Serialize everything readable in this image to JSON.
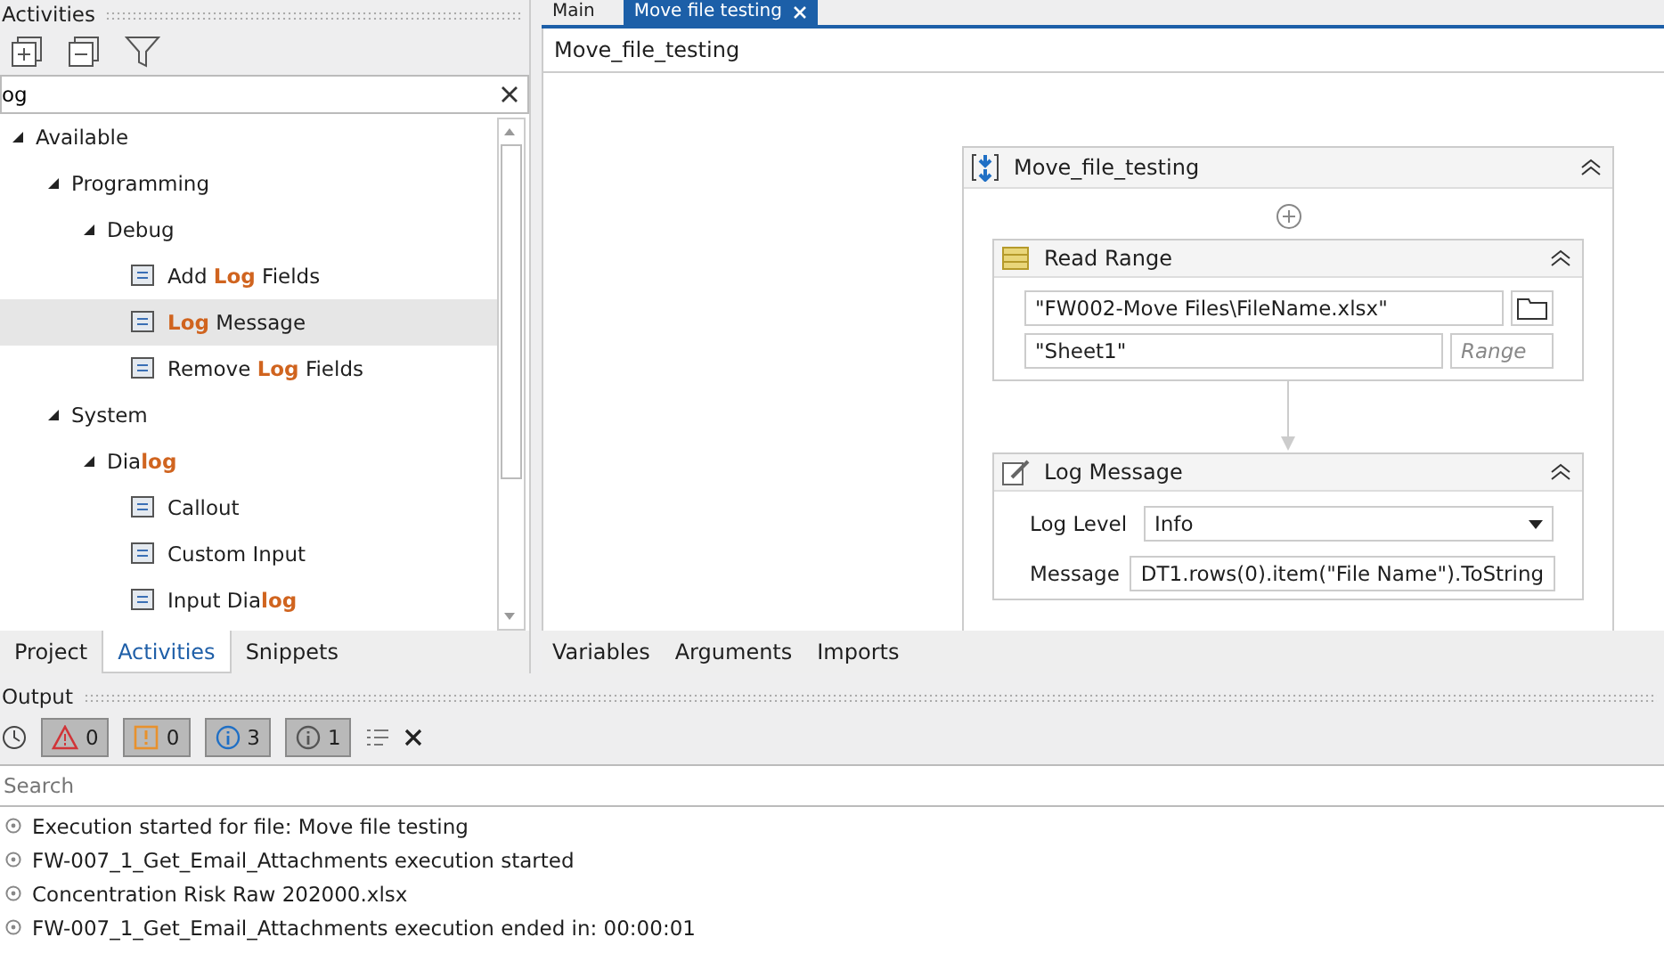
{
  "activities_panel": {
    "title": "Activities",
    "search": {
      "value": "og"
    },
    "tree": [
      {
        "label": "Available",
        "expanded": true,
        "children": [
          {
            "label": "Programming",
            "expanded": true,
            "children": [
              {
                "label": "Debug",
                "expanded": true,
                "children": [
                  {
                    "label": "Add **Log** Fields",
                    "selected": false
                  },
                  {
                    "label": "**Log** Message",
                    "selected": true
                  },
                  {
                    "label": "Remove **Log** Fields",
                    "selected": false
                  }
                ]
              }
            ]
          },
          {
            "label": "System",
            "expanded": true,
            "children": [
              {
                "label": "Dia**log**",
                "expanded": true,
                "children": [
                  {
                    "label": "Callout",
                    "selected": false
                  },
                  {
                    "label": "Custom Input",
                    "selected": false
                  },
                  {
                    "label": "Input Dia**log**",
                    "selected": false
                  }
                ]
              }
            ]
          }
        ]
      }
    ],
    "tabs": [
      {
        "label": "Project",
        "selected": false
      },
      {
        "label": "Activities",
        "selected": true
      },
      {
        "label": "Snippets",
        "selected": false
      }
    ]
  },
  "document_tabs": [
    {
      "label": "Main",
      "selected": false
    },
    {
      "label": "Move file testing",
      "selected": true
    }
  ],
  "breadcrumb": "Move_file_testing",
  "sequence": {
    "title": "Move_file_testing",
    "activities": [
      {
        "kind": "read_range",
        "title": "Read Range",
        "path": "\"FW002-Move Files\\FileName.xlsx\"",
        "sheet": "\"Sheet1\"",
        "range_placeholder": "Range"
      },
      {
        "kind": "log_message",
        "title": "Log Message",
        "fields": [
          {
            "kind": "dropdown",
            "label": "Log Level",
            "value": "Info"
          },
          {
            "kind": "text",
            "label": "Message",
            "value": "DT1.rows(0).item(\"File Name\").ToString"
          }
        ]
      }
    ]
  },
  "designer_tabs": [
    "Variables",
    "Arguments",
    "Imports"
  ],
  "output": {
    "title": "Output",
    "filters": [
      {
        "kind": "error",
        "count": "0",
        "selected": true
      },
      {
        "kind": "warning",
        "count": "0",
        "selected": true
      },
      {
        "kind": "info",
        "count": "3",
        "selected": true
      },
      {
        "kind": "trace",
        "count": "1",
        "selected": true
      }
    ],
    "search": {
      "placeholder": "Search"
    },
    "lines": [
      "Execution started for file: Move file testing",
      "FW-007_1_Get_Email_Attachments execution started",
      "Concentration Risk Raw 202000.xlsx",
      "FW-007_1_Get_Email_Attachments execution ended in: 00:00:01"
    ]
  }
}
